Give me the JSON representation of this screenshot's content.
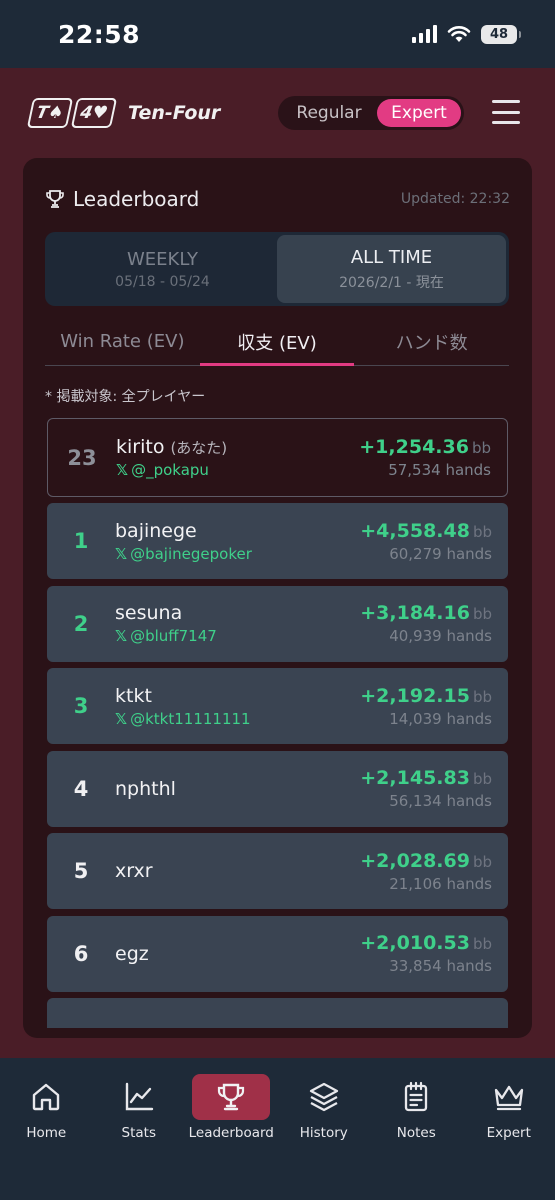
{
  "status_bar": {
    "time": "22:58",
    "battery": "48"
  },
  "header": {
    "logo_cards": [
      "T♠",
      "4♥"
    ],
    "app_name": "Ten-Four",
    "mode_regular": "Regular",
    "mode_expert": "Expert",
    "active_mode": "Expert"
  },
  "leaderboard": {
    "title": "Leaderboard",
    "updated": "Updated: 22:32",
    "period_tabs": [
      {
        "name": "WEEKLY",
        "range": "05/18 - 05/24",
        "active": false
      },
      {
        "name": "ALL TIME",
        "range": "2026/2/1 - 現在",
        "active": true
      }
    ],
    "metric_tabs": [
      {
        "label": "Win Rate (EV)",
        "active": false
      },
      {
        "label": "収支 (EV)",
        "active": true
      },
      {
        "label": "ハンド数",
        "active": false
      }
    ],
    "note": "* 掲載対象: 全プレイヤー",
    "unit": "bb",
    "me": {
      "rank": "23",
      "name": "kirito",
      "you_label": "(あなた)",
      "handle": "@_pokapu",
      "profit": "+1,254.36",
      "hands": "57,534 hands"
    },
    "rows": [
      {
        "rank": "1",
        "name": "bajinege",
        "handle": "@bajinegepoker",
        "profit": "+4,558.48",
        "hands": "60,279 hands"
      },
      {
        "rank": "2",
        "name": "sesuna",
        "handle": "@bluff7147",
        "profit": "+3,184.16",
        "hands": "40,939 hands"
      },
      {
        "rank": "3",
        "name": "ktkt",
        "handle": "@ktkt11111111",
        "profit": "+2,192.15",
        "hands": "14,039 hands"
      },
      {
        "rank": "4",
        "name": "nphthl",
        "handle": "",
        "profit": "+2,145.83",
        "hands": "56,134 hands"
      },
      {
        "rank": "5",
        "name": "xrxr",
        "handle": "",
        "profit": "+2,028.69",
        "hands": "21,106 hands"
      },
      {
        "rank": "6",
        "name": "egz",
        "handle": "",
        "profit": "+2,010.53",
        "hands": "33,854 hands"
      }
    ]
  },
  "bottom_nav": [
    {
      "label": "Home",
      "icon": "home-icon",
      "active": false
    },
    {
      "label": "Stats",
      "icon": "chart-icon",
      "active": false
    },
    {
      "label": "Leaderboard",
      "icon": "trophy-icon",
      "active": true
    },
    {
      "label": "History",
      "icon": "layers-icon",
      "active": false
    },
    {
      "label": "Notes",
      "icon": "notepad-icon",
      "active": false
    },
    {
      "label": "Expert",
      "icon": "crown-icon",
      "active": false
    }
  ],
  "colors": {
    "accent_pink": "#e23b83",
    "positive_green": "#3fd08a",
    "nav_active": "#a03048"
  }
}
